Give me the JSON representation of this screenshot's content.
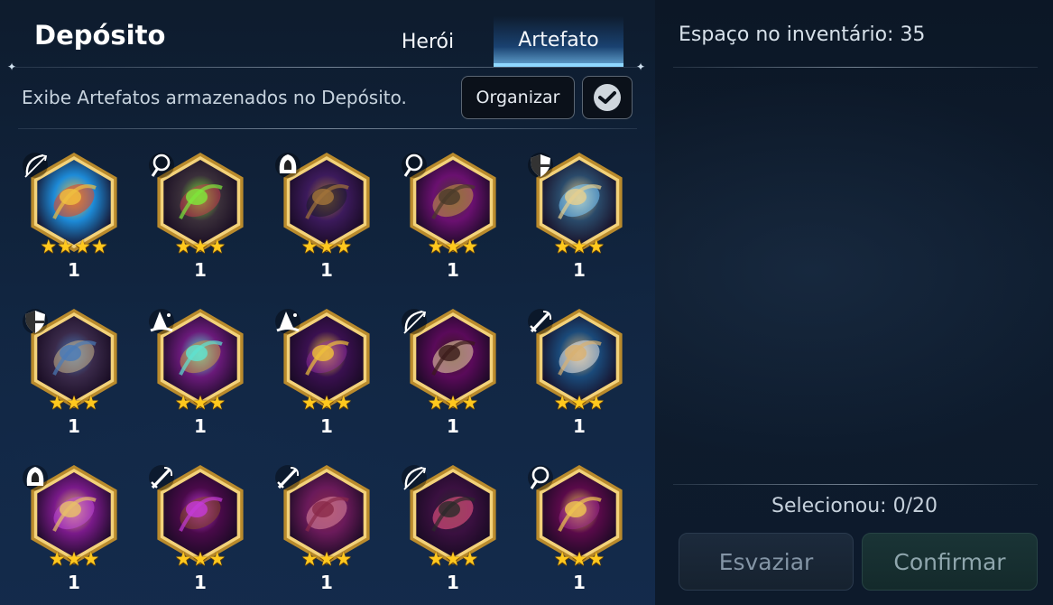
{
  "header": {
    "title": "Depósito",
    "tabs": [
      {
        "label": "Herói",
        "active": false
      },
      {
        "label": "Artefato",
        "active": true
      }
    ]
  },
  "toolbar": {
    "description": "Exibe Artefatos armazenados no Depósito.",
    "organize_label": "Organizar",
    "select_all_icon": "check-circle-icon"
  },
  "artifacts": [
    {
      "class_icon": "bow-icon",
      "art": "rainbow-potion",
      "stars": 4,
      "count": "1",
      "palette": [
        "#1d8bd8",
        "#f0c040",
        "#e8441f"
      ]
    },
    {
      "class_icon": "staff-icon",
      "art": "green-eye-cage",
      "stars": 3,
      "count": "1",
      "palette": [
        "#3a2f3a",
        "#7ee83a",
        "#c23a4a"
      ]
    },
    {
      "class_icon": "hood-icon",
      "art": "dark-branch",
      "stars": 3,
      "count": "1",
      "palette": [
        "#3c1a5c",
        "#a2743a",
        "#1b1b28"
      ]
    },
    {
      "class_icon": "staff-icon",
      "art": "book-stack",
      "stars": 3,
      "count": "1",
      "palette": [
        "#6a1070",
        "#4a3a2a",
        "#c89a46"
      ]
    },
    {
      "class_icon": "shield-icon",
      "art": "golden-tablet",
      "stars": 3,
      "count": "1",
      "palette": [
        "#2a4a6a",
        "#e6cf8e",
        "#7acbff"
      ]
    },
    {
      "class_icon": "shield-icon",
      "art": "blue-sword",
      "stars": 3,
      "count": "1",
      "palette": [
        "#3a2a4a",
        "#4a7ab8",
        "#c8b48a"
      ]
    },
    {
      "class_icon": "wizard-icon",
      "art": "glowing-tome",
      "stars": 3,
      "count": "1",
      "palette": [
        "#6a1a7a",
        "#5ee3d2",
        "#c89a46"
      ]
    },
    {
      "class_icon": "wizard-icon",
      "art": "gold-crown",
      "stars": 3,
      "count": "1",
      "palette": [
        "#3a1050",
        "#f0c23a",
        "#8a2a9a"
      ]
    },
    {
      "class_icon": "bow-icon",
      "art": "crossbow",
      "stars": 3,
      "count": "1",
      "palette": [
        "#5a0a5a",
        "#3a1a1a",
        "#f0d8a8"
      ]
    },
    {
      "class_icon": "thief-icon",
      "art": "golden-gauntlet",
      "stars": 3,
      "count": "1",
      "palette": [
        "#1a4a7a",
        "#d8b070",
        "#e8e8e8"
      ]
    },
    {
      "class_icon": "hood-icon",
      "art": "crossed-blades",
      "stars": 3,
      "count": "1",
      "palette": [
        "#7a1a8a",
        "#e8c068",
        "#c04ad8"
      ]
    },
    {
      "class_icon": "thief-icon",
      "art": "dark-dagger",
      "stars": 3,
      "count": "1",
      "palette": [
        "#4a0a4a",
        "#c43ad8",
        "#8a4a2a"
      ]
    },
    {
      "class_icon": "thief-icon",
      "art": "red-glove",
      "stars": 3,
      "count": "1",
      "palette": [
        "#6a1a5a",
        "#8a2a4a",
        "#e08aa0"
      ]
    },
    {
      "class_icon": "bow-icon",
      "art": "pink-cannon",
      "stars": 3,
      "count": "1",
      "palette": [
        "#3a1040",
        "#2a2a2a",
        "#ff5a8a"
      ]
    },
    {
      "class_icon": "staff-icon",
      "art": "gold-orb",
      "stars": 3,
      "count": "1",
      "palette": [
        "#5a0a4a",
        "#f0c850",
        "#9a2a8a"
      ]
    }
  ],
  "inventory": {
    "space_text": "Espaço no inventário: 35",
    "selected_text": "Selecionou: 0/20",
    "empty_label": "Esvaziar",
    "confirm_label": "Confirmar"
  }
}
